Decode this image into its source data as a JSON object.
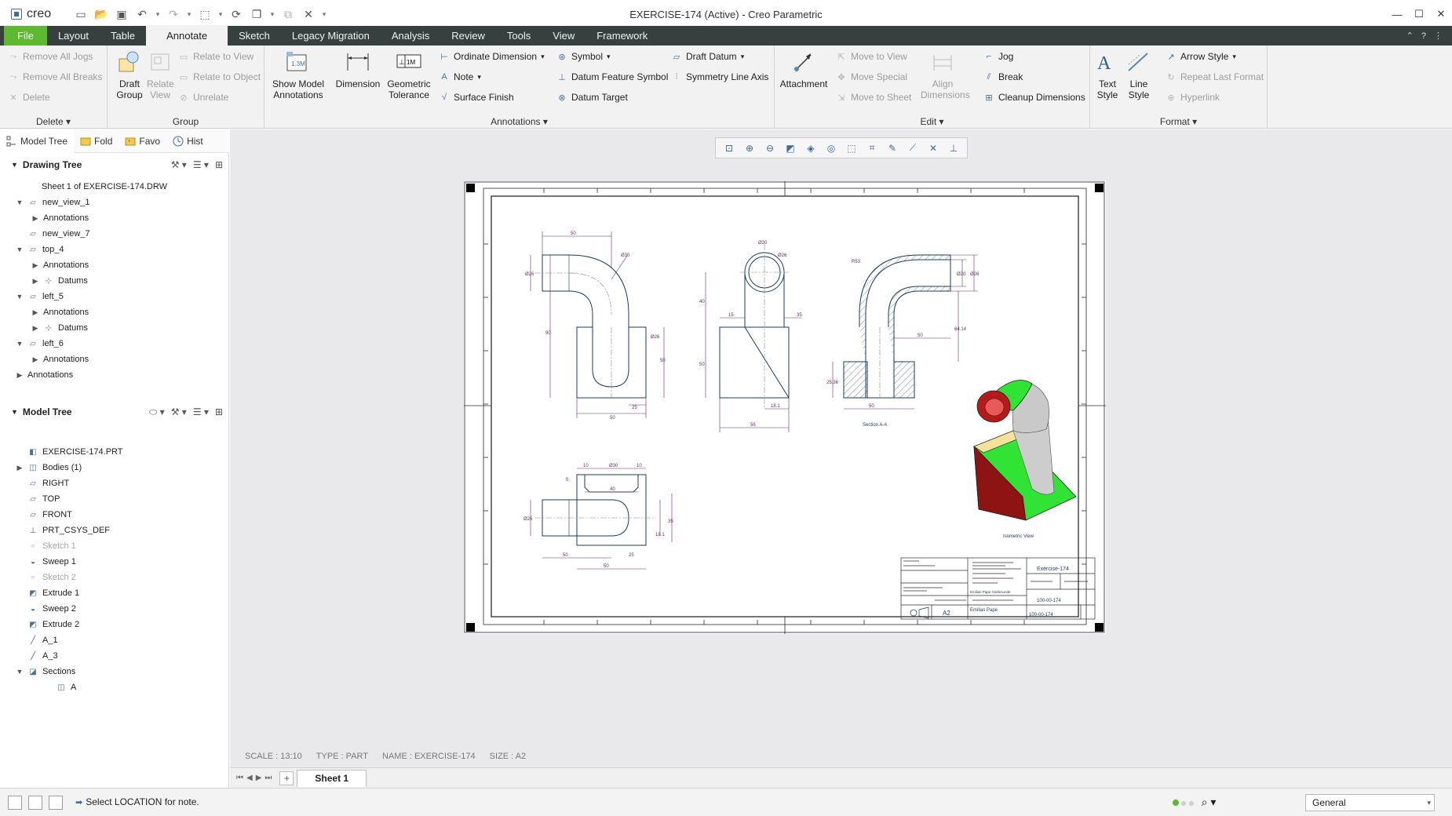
{
  "app": {
    "title": "EXERCISE-174 (Active) - Creo Parametric",
    "logo_text": "creo"
  },
  "menu": {
    "tabs": [
      "File",
      "Layout",
      "Table",
      "Annotate",
      "Sketch",
      "Legacy Migration",
      "Analysis",
      "Review",
      "Tools",
      "View",
      "Framework"
    ],
    "active": "Annotate"
  },
  "ribbon": {
    "delete_group": {
      "label": "Delete",
      "remove_all_jogs": "Remove All Jogs",
      "remove_all_breaks": "Remove All Breaks",
      "delete": "Delete"
    },
    "group_group": {
      "label": "Group",
      "draft_group": "Draft Group",
      "relate_view": "Relate View",
      "relate_to_view": "Relate to View",
      "relate_to_object": "Relate to Object",
      "unrelate": "Unrelate"
    },
    "annotations_group": {
      "label": "Annotations",
      "show_model_annotations": "Show Model Annotations",
      "dimension": "Dimension",
      "geometric_tolerance": "Geometric Tolerance",
      "ordinate_dimension": "Ordinate Dimension",
      "note": "Note",
      "surface_finish": "Surface Finish",
      "symbol": "Symbol",
      "datum_feature_symbol": "Datum Feature Symbol",
      "datum_target": "Datum Target",
      "draft_datum": "Draft Datum",
      "symmetry_line_axis": "Symmetry Line Axis"
    },
    "edit_group": {
      "label": "Edit",
      "attachment": "Attachment",
      "move_to_view": "Move to View",
      "move_special": "Move Special",
      "move_to_sheet": "Move to Sheet",
      "align_dimensions": "Align Dimensions",
      "jog": "Jog",
      "break": "Break",
      "cleanup_dimensions": "Cleanup Dimensions"
    },
    "format_group": {
      "label": "Format",
      "text_style": "Text Style",
      "line_style": "Line Style",
      "arrow_style": "Arrow Style",
      "repeat_last_format": "Repeat Last Format",
      "hyperlink": "Hyperlink"
    }
  },
  "navtabs": {
    "model_tree": "Model Tree",
    "folder": "Fold",
    "favorites": "Favo",
    "history": "Hist"
  },
  "drawing_tree": {
    "title": "Drawing Tree",
    "items": [
      {
        "label": "Sheet 1 of EXERCISE-174.DRW",
        "level": 0,
        "exp": ""
      },
      {
        "label": "new_view_1",
        "level": 0,
        "exp": "▼"
      },
      {
        "label": "Annotations",
        "level": 1,
        "exp": "▶"
      },
      {
        "label": "new_view_7",
        "level": 0,
        "exp": ""
      },
      {
        "label": "top_4",
        "level": 0,
        "exp": "▼"
      },
      {
        "label": "Annotations",
        "level": 1,
        "exp": "▶"
      },
      {
        "label": "Datums",
        "level": 1,
        "exp": "▶"
      },
      {
        "label": "left_5",
        "level": 0,
        "exp": "▼"
      },
      {
        "label": "Annotations",
        "level": 1,
        "exp": "▶"
      },
      {
        "label": "Datums",
        "level": 1,
        "exp": "▶"
      },
      {
        "label": "left_6",
        "level": 0,
        "exp": "▼"
      },
      {
        "label": "Annotations",
        "level": 1,
        "exp": "▶"
      },
      {
        "label": "Annotations",
        "level": -1,
        "exp": "▶"
      }
    ]
  },
  "model_tree": {
    "title": "Model Tree",
    "items": [
      {
        "label": "EXERCISE-174.PRT",
        "dim": false,
        "exp": ""
      },
      {
        "label": "Bodies (1)",
        "dim": false,
        "exp": "▶"
      },
      {
        "label": "RIGHT",
        "dim": false,
        "exp": ""
      },
      {
        "label": "TOP",
        "dim": false,
        "exp": ""
      },
      {
        "label": "FRONT",
        "dim": false,
        "exp": ""
      },
      {
        "label": "PRT_CSYS_DEF",
        "dim": false,
        "exp": ""
      },
      {
        "label": "Sketch 1",
        "dim": true,
        "exp": ""
      },
      {
        "label": "Sweep 1",
        "dim": false,
        "exp": ""
      },
      {
        "label": "Sketch 2",
        "dim": true,
        "exp": ""
      },
      {
        "label": "Extrude 1",
        "dim": false,
        "exp": ""
      },
      {
        "label": "Sweep 2",
        "dim": false,
        "exp": ""
      },
      {
        "label": "Extrude 2",
        "dim": false,
        "exp": ""
      },
      {
        "label": "A_1",
        "dim": false,
        "exp": ""
      },
      {
        "label": "A_3",
        "dim": false,
        "exp": ""
      },
      {
        "label": "Sections",
        "dim": false,
        "exp": "▼"
      },
      {
        "label": "A",
        "dim": false,
        "exp": ""
      }
    ]
  },
  "drawing": {
    "section_label": "Section A-A",
    "iso_label": "Isometric View",
    "title_block": {
      "title": "Exercise-174",
      "number": "100-00-174",
      "number2": "100-00-174",
      "size": "A2",
      "name": "Emilias Pape",
      "desc": "Emilias Pape Gatlinsunde"
    },
    "dims": {
      "d50": "50",
      "d30": "Ø30",
      "d26": "Ø26",
      "d90": "90",
      "d25": "25",
      "d40": "40",
      "d15": "15",
      "d35": "35",
      "d181": "18.1",
      "d56": "56",
      "d53": "R53",
      "d20": "Ø20",
      "d644": "64.14",
      "d2536": "25.36",
      "d10": "10",
      "d5": "5"
    }
  },
  "status": {
    "scale": "SCALE : 13:10",
    "type": "TYPE : PART",
    "name": "NAME : EXERCISE-174",
    "size": "SIZE : A2"
  },
  "sheet": {
    "tab": "Sheet 1"
  },
  "bottom": {
    "message": "Select LOCATION for note.",
    "filter": "General"
  },
  "colors": {
    "menubar": "#35403f",
    "file_tab": "#5cb930",
    "line": "#1d3b57",
    "dim": "#6a2c6a",
    "iso_green": "#31e335",
    "iso_red": "#8e1414"
  }
}
